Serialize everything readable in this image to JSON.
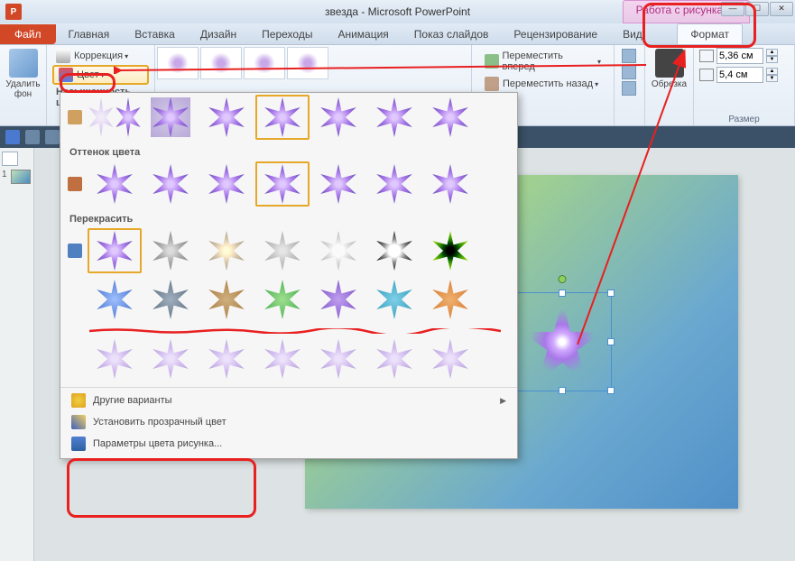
{
  "title": "звезда - Microsoft PowerPoint",
  "contextual_tab": "Работа с рисунками",
  "win_controls": {
    "min": "—",
    "max": "☐",
    "close": "✕"
  },
  "tabs": {
    "file": "Файл",
    "items": [
      "Главная",
      "Вставка",
      "Дизайн",
      "Переходы",
      "Анимация",
      "Показ слайдов",
      "Рецензирование",
      "Вид"
    ],
    "format": "Формат"
  },
  "ribbon": {
    "remove_bg": "Удалить фон",
    "corrections": "Коррекция",
    "color": "Цвет",
    "saturation_heading": "Насыщенность цвета",
    "bring_forward": "Переместить вперед",
    "send_backward": "Переместить назад",
    "crop": "Обрезка",
    "size_group": "Размер",
    "height": "5,36 см",
    "width": "5,4 см"
  },
  "popup": {
    "section_tone": "Оттенок цвета",
    "section_recolor": "Перекрасить",
    "more_variants": "Другие варианты",
    "set_transparent": "Установить прозрачный цвет",
    "params": "Параметры цвета рисунка..."
  },
  "thumb_number": "1"
}
